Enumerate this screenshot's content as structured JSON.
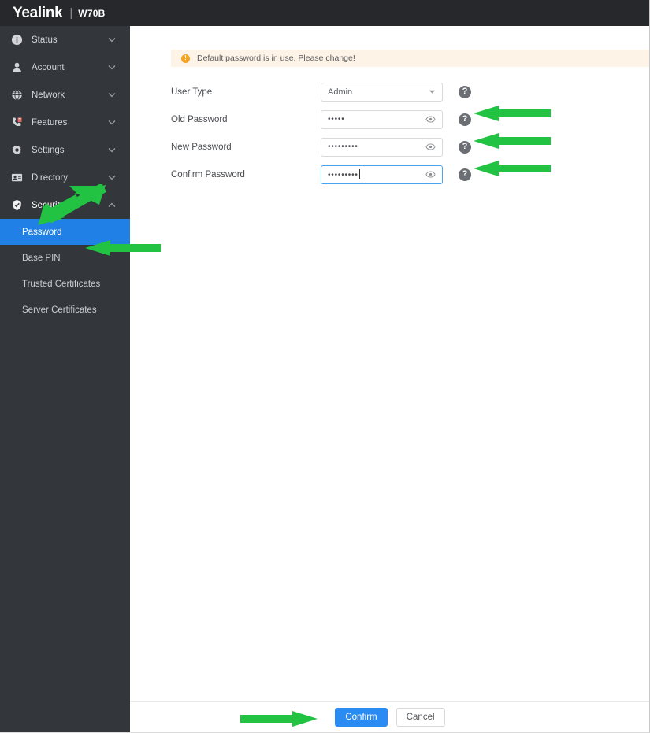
{
  "header": {
    "brand": "Yealink",
    "separator": "|",
    "model": "W70B"
  },
  "sidebar": {
    "items": [
      {
        "label": "Status",
        "icon": "info-circle-icon",
        "chevron": "chevron-down"
      },
      {
        "label": "Account",
        "icon": "user-icon",
        "chevron": "chevron-down"
      },
      {
        "label": "Network",
        "icon": "globe-icon",
        "chevron": "chevron-down"
      },
      {
        "label": "Features",
        "icon": "phone-icon",
        "chevron": "chevron-down"
      },
      {
        "label": "Settings",
        "icon": "gear-icon",
        "chevron": "chevron-down"
      },
      {
        "label": "Directory",
        "icon": "contact-card-icon",
        "chevron": "chevron-down"
      },
      {
        "label": "Security",
        "icon": "shield-icon",
        "chevron": "chevron-up"
      }
    ],
    "security_subitems": [
      {
        "label": "Password",
        "active": true
      },
      {
        "label": "Base PIN",
        "active": false
      },
      {
        "label": "Trusted Certificates",
        "active": false
      },
      {
        "label": "Server Certificates",
        "active": false
      }
    ],
    "active_item": "Security",
    "active_subitem": "Password",
    "active_color": "#2080e5",
    "background": "#33363b"
  },
  "main": {
    "banner": {
      "icon": "exclamation-circle-icon",
      "glyph": "!",
      "text": "Default password is in use. Please change!",
      "background": "#fdf3e6",
      "icon_color": "#f6a321"
    },
    "fields": [
      {
        "label": "User Type",
        "type": "select",
        "value": "Admin",
        "help_glyph": "?"
      },
      {
        "label": "Old Password",
        "type": "password",
        "value": "•••••",
        "focused": false,
        "help_glyph": "?"
      },
      {
        "label": "New Password",
        "type": "password",
        "value": "•••••••••",
        "focused": false,
        "help_glyph": "?"
      },
      {
        "label": "Confirm Password",
        "type": "password",
        "value": "•••••••••",
        "focused": true,
        "help_glyph": "?"
      }
    ],
    "footer": {
      "confirm_label": "Confirm",
      "cancel_label": "Cancel",
      "confirm_color": "#2a8bf2"
    }
  },
  "annotations": {
    "arrow_color": "#22c243",
    "arrows": [
      {
        "name": "arrow-to-security",
        "direction": "diagonal-down-left"
      },
      {
        "name": "arrow-to-password",
        "direction": "left"
      },
      {
        "name": "arrow-to-old-password",
        "direction": "left"
      },
      {
        "name": "arrow-to-new-password",
        "direction": "left"
      },
      {
        "name": "arrow-to-confirm-password",
        "direction": "left"
      },
      {
        "name": "arrow-to-confirm-button",
        "direction": "right"
      }
    ]
  }
}
